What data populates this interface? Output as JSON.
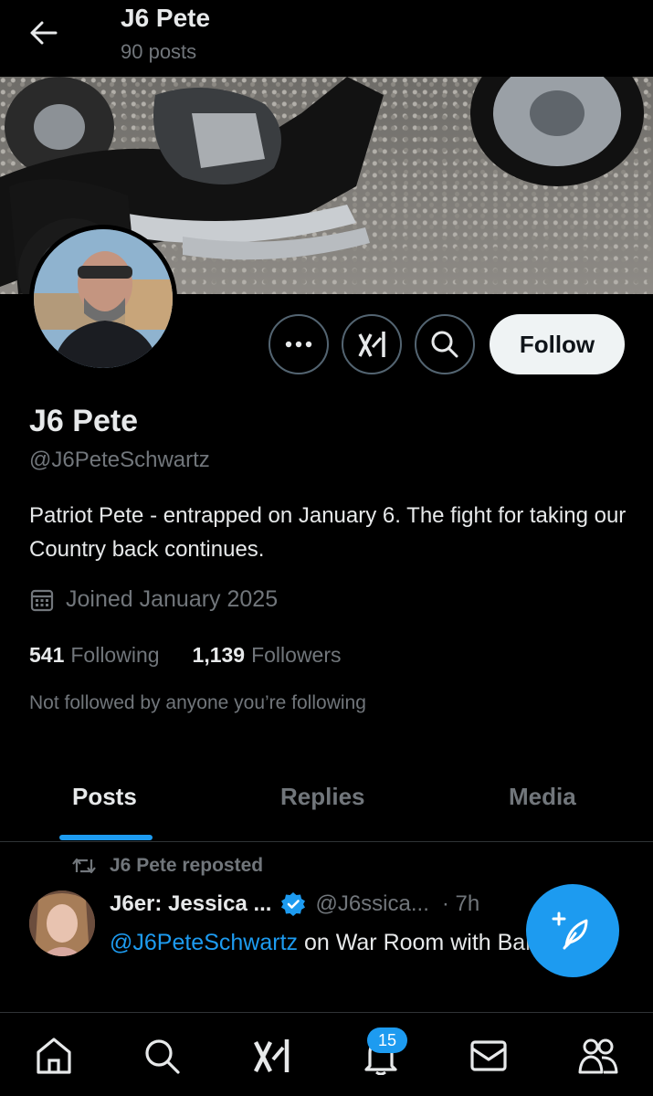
{
  "header": {
    "title": "J6 Pete",
    "posts_count": "90 posts"
  },
  "profile": {
    "name": "J6 Pete",
    "handle": "@J6PeteSchwartz",
    "bio": "Patriot Pete - entrapped on January 6. The fight for taking our Country back continues.",
    "joined": "Joined January 2025",
    "following_count": "541",
    "following_label": "Following",
    "followers_count": "1,139",
    "followers_label": "Followers",
    "not_followed": "Not followed by anyone you’re following"
  },
  "actions": {
    "follow_label": "Follow"
  },
  "tabs": [
    {
      "label": "Posts",
      "active": true
    },
    {
      "label": "Replies",
      "active": false
    },
    {
      "label": "Media",
      "active": false
    }
  ],
  "tweet": {
    "repost_label": "J6 Pete reposted",
    "author_name": "J6er: Jessica ...",
    "author_handle": "@J6ssica...",
    "time": "· 7h",
    "mention": "@J6PeteSchwartz",
    "text_rest": " on War Room with Bannon."
  },
  "nav": {
    "notifications_badge": "15"
  },
  "colors": {
    "accent": "#1d9bf0",
    "background": "#000000",
    "secondary_text": "#71767b"
  }
}
